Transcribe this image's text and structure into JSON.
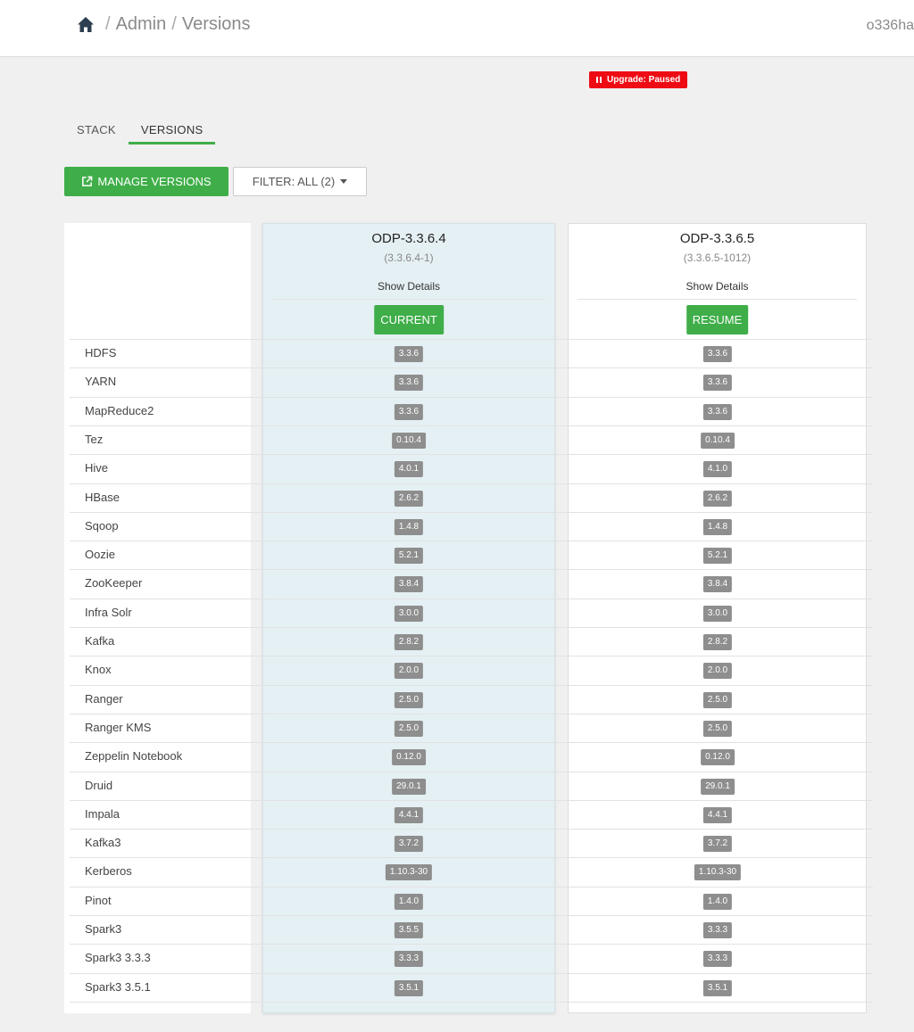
{
  "header": {
    "home_icon": "home-icon",
    "breadcrumbs": [
      "Admin",
      "Versions"
    ],
    "separator": "/",
    "cluster": "o336ha"
  },
  "upgrade_badge": {
    "label": "Upgrade: Paused",
    "icon": "pause-icon",
    "color": "#ee0b14"
  },
  "tabs": [
    {
      "label": "STACK",
      "active": false
    },
    {
      "label": "VERSIONS",
      "active": true
    }
  ],
  "toolbar": {
    "manage_label": "MANAGE VERSIONS",
    "manage_icon": "external-link-icon",
    "filter_label": "FILTER: ALL (2)"
  },
  "versions": [
    {
      "name": "ODP-3.3.6.4",
      "build": "(3.3.6.4-1)",
      "details_label": "Show Details",
      "action_label": "CURRENT",
      "is_current": true
    },
    {
      "name": "ODP-3.3.6.5",
      "build": "(3.3.6.5-1012)",
      "details_label": "Show Details",
      "action_label": "RESUME",
      "is_current": false
    }
  ],
  "services": [
    {
      "name": "HDFS",
      "v1": "3.3.6",
      "v2": "3.3.6"
    },
    {
      "name": "YARN",
      "v1": "3.3.6",
      "v2": "3.3.6"
    },
    {
      "name": "MapReduce2",
      "v1": "3.3.6",
      "v2": "3.3.6"
    },
    {
      "name": "Tez",
      "v1": "0.10.4",
      "v2": "0.10.4"
    },
    {
      "name": "Hive",
      "v1": "4.0.1",
      "v2": "4.1.0"
    },
    {
      "name": "HBase",
      "v1": "2.6.2",
      "v2": "2.6.2"
    },
    {
      "name": "Sqoop",
      "v1": "1.4.8",
      "v2": "1.4.8"
    },
    {
      "name": "Oozie",
      "v1": "5.2.1",
      "v2": "5.2.1"
    },
    {
      "name": "ZooKeeper",
      "v1": "3.8.4",
      "v2": "3.8.4"
    },
    {
      "name": "Infra Solr",
      "v1": "3.0.0",
      "v2": "3.0.0"
    },
    {
      "name": "Kafka",
      "v1": "2.8.2",
      "v2": "2.8.2"
    },
    {
      "name": "Knox",
      "v1": "2.0.0",
      "v2": "2.0.0"
    },
    {
      "name": "Ranger",
      "v1": "2.5.0",
      "v2": "2.5.0"
    },
    {
      "name": "Ranger KMS",
      "v1": "2.5.0",
      "v2": "2.5.0"
    },
    {
      "name": "Zeppelin Notebook",
      "v1": "0.12.0",
      "v2": "0.12.0"
    },
    {
      "name": "Druid",
      "v1": "29.0.1",
      "v2": "29.0.1"
    },
    {
      "name": "Impala",
      "v1": "4.4.1",
      "v2": "4.4.1"
    },
    {
      "name": "Kafka3",
      "v1": "3.7.2",
      "v2": "3.7.2"
    },
    {
      "name": "Kerberos",
      "v1": "1.10.3-30",
      "v2": "1.10.3-30"
    },
    {
      "name": "Pinot",
      "v1": "1.4.0",
      "v2": "1.4.0"
    },
    {
      "name": "Spark3",
      "v1": "3.5.5",
      "v2": "3.3.3"
    },
    {
      "name": "Spark3 3.3.3",
      "v1": "3.3.3",
      "v2": "3.3.3"
    },
    {
      "name": "Spark3 3.5.1",
      "v1": "3.5.1",
      "v2": "3.5.1"
    }
  ]
}
